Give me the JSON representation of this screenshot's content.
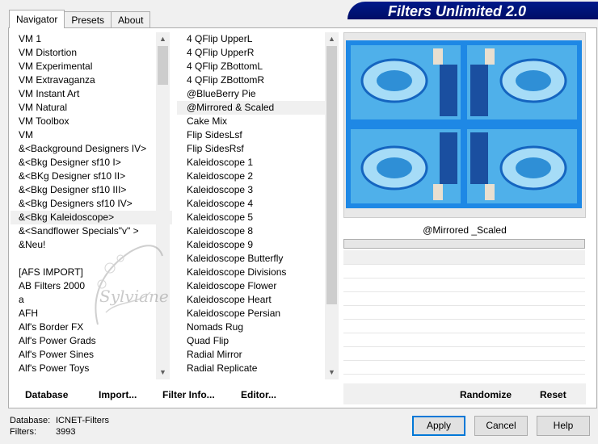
{
  "tabs": [
    {
      "label": "Navigator"
    },
    {
      "label": "Presets"
    },
    {
      "label": "About"
    }
  ],
  "banner": {
    "title": "Filters Unlimited 2.0"
  },
  "categories": [
    "VM 1",
    "VM Distortion",
    "VM Experimental",
    "VM Extravaganza",
    "VM Instant Art",
    "VM Natural",
    "VM Toolbox",
    "VM",
    "&<Background Designers IV>",
    "&<Bkg Designer sf10 I>",
    "&<BKg Designer sf10 II>",
    "&<Bkg Designer sf10 III>",
    "&<Bkg Designers sf10 IV>",
    "&<Bkg Kaleidoscope>",
    "&<Sandflower Specials\"v\" >",
    "&Neu!",
    "",
    "[AFS IMPORT]",
    "AB Filters 2000",
    "a",
    "AFH",
    "Alf's Border FX",
    "Alf's Power Grads",
    "Alf's Power Sines",
    "Alf's Power Toys"
  ],
  "filters": [
    "4 QFlip UpperL",
    "4 QFlip UpperR",
    "4 QFlip ZBottomL",
    "4 QFlip ZBottomR",
    "@BlueBerry Pie",
    "@Mirrored & Scaled",
    "Cake Mix",
    "Flip SidesLsf",
    "Flip SidesRsf",
    "Kaleidoscope 1",
    "Kaleidoscope 2",
    "Kaleidoscope 3",
    "Kaleidoscope 4",
    "Kaleidoscope 5",
    "Kaleidoscope 8",
    "Kaleidoscope 9",
    "Kaleidoscope Butterfly",
    "Kaleidoscope Divisions",
    "Kaleidoscope Flower",
    "Kaleidoscope Heart",
    "Kaleidoscope Persian",
    "Nomads Rug",
    "Quad Flip",
    "Radial Mirror",
    "Radial Replicate"
  ],
  "selected_category_index": 13,
  "selected_filter_index": 5,
  "selected_filter_name": "@Mirrored _Scaled",
  "watermark_text": "Sylviane",
  "bottom_actions": {
    "database": "Database",
    "import": "Import...",
    "filter_info": "Filter Info...",
    "editor": "Editor...",
    "randomize": "Randomize",
    "reset": "Reset"
  },
  "info": {
    "database_label": "Database:",
    "database_value": "ICNET-Filters",
    "filters_label": "Filters:",
    "filters_value": "3993"
  },
  "buttons": {
    "apply": "Apply",
    "cancel": "Cancel",
    "help": "Help"
  },
  "colors": {
    "banner_bg": "#000c66",
    "preview_bg": "#2a8ee0",
    "accent": "#0078d7"
  }
}
